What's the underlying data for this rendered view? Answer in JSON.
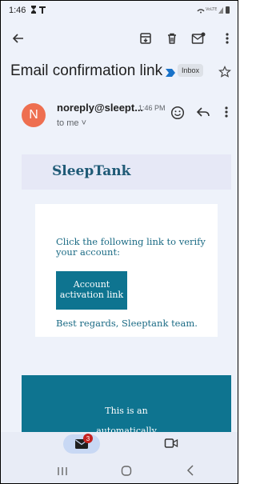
{
  "status_bar": {
    "time": "1:46",
    "left_icons": "⏳ T",
    "right_icons": "VoLTE"
  },
  "action_bar": {
    "icons": [
      "back-arrow-icon",
      "archive-icon",
      "trash-icon",
      "mark-unread-icon",
      "more-vert-icon"
    ]
  },
  "email": {
    "subject": "Email confirmation link",
    "label": "Inbox",
    "sender_initial": "N",
    "sender": "noreply@sleept...",
    "time": "1:46 PM",
    "recipient": "to me ˅"
  },
  "body": {
    "brand": "SleepTank",
    "verify_text": "Click the following link to verify your account:",
    "button_line1": "Account",
    "button_line2": "activation link",
    "regards": "Best regards, Sleeptank team.",
    "footer_line1": "This is an",
    "footer_line2": "automatically"
  },
  "bottom_nav": {
    "mail_badge": "3"
  },
  "colors": {
    "accent_teal": "#0e7490",
    "avatar": "#ee6f50",
    "badge": "#c5221f"
  }
}
